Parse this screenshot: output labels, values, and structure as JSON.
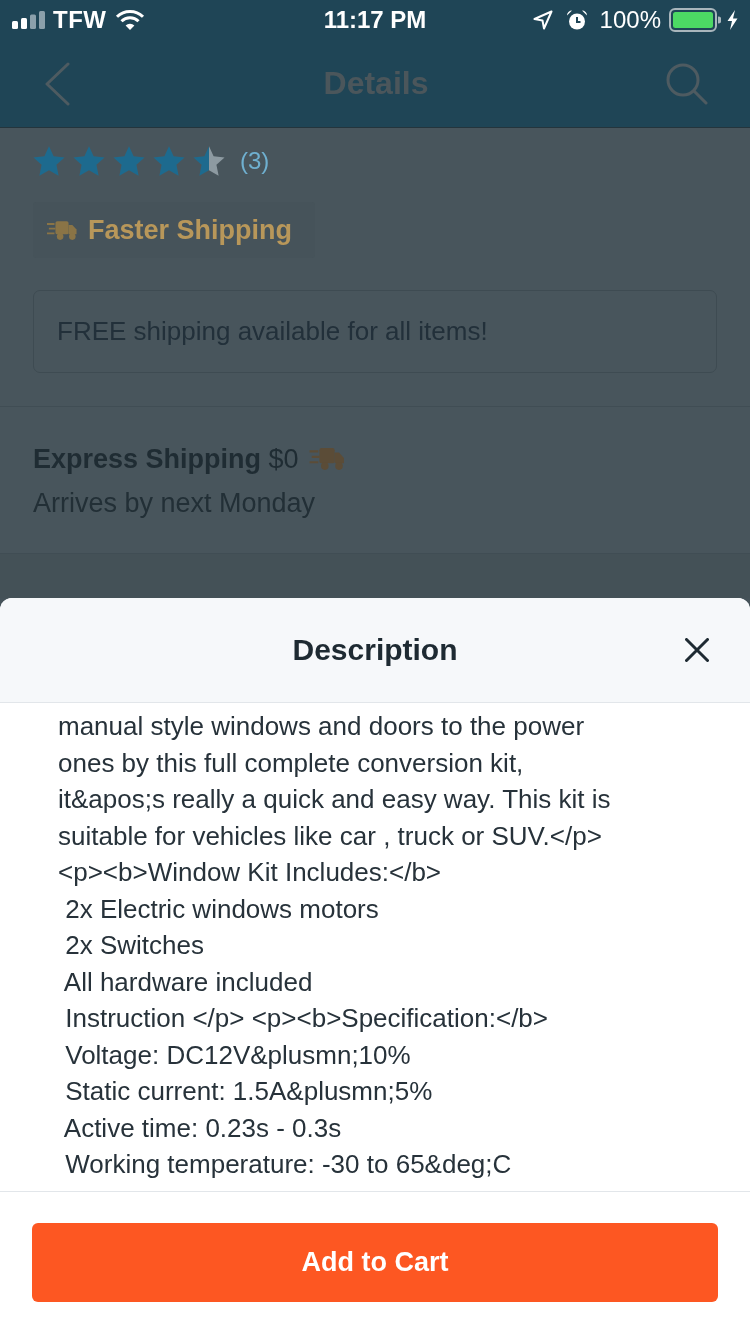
{
  "status_bar": {
    "carrier": "TFW",
    "time": "11:17 PM",
    "battery": "100%"
  },
  "nav_bar": {
    "title": "Details"
  },
  "product": {
    "rating": {
      "stars": 4.5,
      "count": "(3)"
    },
    "badge": "Faster Shipping",
    "notice": "FREE shipping available for all items!"
  },
  "shipping": {
    "method": "**Express Shipping** $0",
    "arrival": "Arrives by next Monday"
  },
  "description_sheet": {
    "title": "Description",
    "lines": [
      "manual style windows and doors to the power",
      "ones by this full complete conversion kit,",
      "it&apos;s really a quick and easy way. This kit is",
      "suitable for vehicles like car , truck or SUV.</p>",
      "<p><b>Window Kit Includes:</b>",
      " 2x Electric windows motors",
      " 2x Switches",
      " All hardware included",
      " Instruction </p> <p><b>Specification:</b>",
      " Voltage: DC12V&plusmn;10%",
      " Static current: 1.5A&plusmn;5%",
      " Active time: 0.23s - 0.3s",
      " Working temperature: -30 to 65&deg;C"
    ]
  },
  "add_to_cart_button": {
    "label": "Add to Cart"
  }
}
